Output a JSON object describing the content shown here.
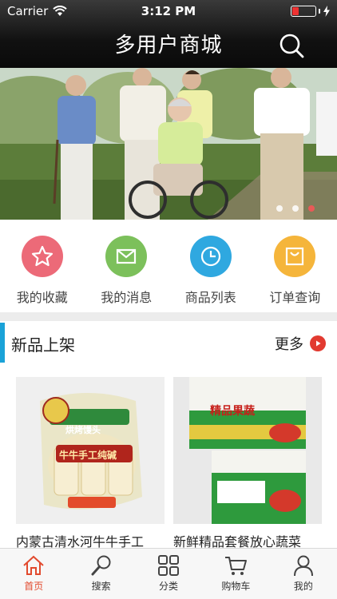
{
  "status_bar": {
    "carrier": "Carrier",
    "time": "3:12 PM"
  },
  "header": {
    "title": "多用户商城",
    "search_icon": "search-icon"
  },
  "banner": {
    "slide_count": 3,
    "active_slide": 3
  },
  "quick_menu": [
    {
      "label": "我的收藏",
      "icon": "star-icon",
      "color": "#ec6a78"
    },
    {
      "label": "我的消息",
      "icon": "envelope-icon",
      "color": "#7cc05b"
    },
    {
      "label": "商品列表",
      "icon": "clock-icon",
      "color": "#2fa8e0"
    },
    {
      "label": "订单查询",
      "icon": "bag-icon",
      "color": "#f5b53b"
    }
  ],
  "section": {
    "title": "新品上架",
    "more_label": "更多",
    "accent": "#1aa2d8"
  },
  "products": [
    {
      "name": "内蒙古清水河牛牛手工",
      "package_text": "牛牛手工纯碱",
      "package_title": "烘烤馒头"
    },
    {
      "name": "新鲜精品套餐放心蔬菜",
      "package_text": "精品果蔬",
      "package_title": "精品果蔬"
    }
  ],
  "tabbar": [
    {
      "label": "首页",
      "icon": "home-icon",
      "active": true
    },
    {
      "label": "搜索",
      "icon": "search-icon",
      "active": false
    },
    {
      "label": "分类",
      "icon": "grid-icon",
      "active": false
    },
    {
      "label": "购物车",
      "icon": "cart-icon",
      "active": false
    },
    {
      "label": "我的",
      "icon": "user-icon",
      "active": false
    }
  ],
  "colors": {
    "active_tab": "#e24a2e",
    "more_arrow": "#e23a30"
  }
}
